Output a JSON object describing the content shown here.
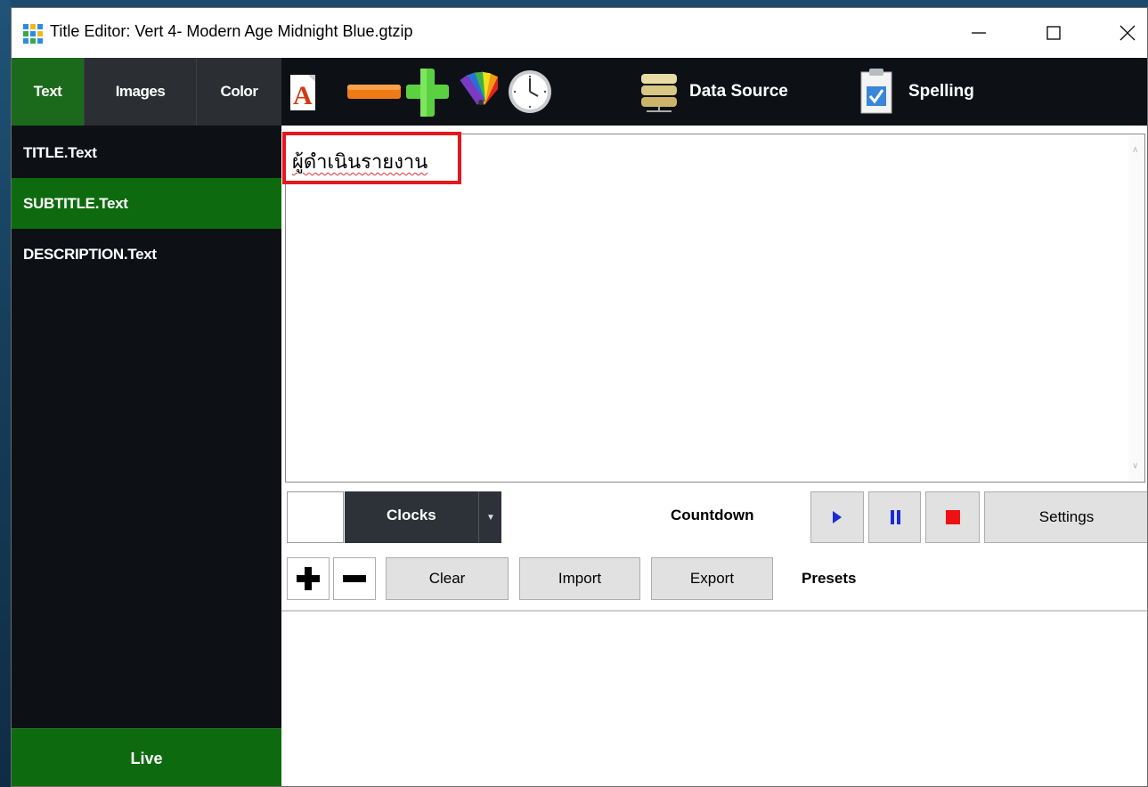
{
  "window": {
    "title": "Title Editor: Vert 4- Modern Age Midnight Blue.gtzip"
  },
  "sidebar": {
    "tabs": [
      {
        "label": "Text",
        "active": true
      },
      {
        "label": "Images",
        "active": false
      },
      {
        "label": "Color",
        "active": false
      }
    ],
    "fields": [
      {
        "label": "TITLE.Text",
        "active": false
      },
      {
        "label": "SUBTITLE.Text",
        "active": true
      },
      {
        "label": "DESCRIPTION.Text",
        "active": false
      }
    ],
    "live_label": "Live"
  },
  "toolbar": {
    "data_source_label": "Data Source",
    "spelling_label": "Spelling",
    "icons": [
      "font-icon",
      "minus-icon",
      "plus-icon",
      "color-palette-icon",
      "clock-icon",
      "database-icon",
      "spellcheck-icon"
    ]
  },
  "editor": {
    "text": "ผู้ดำเนินรายงาน"
  },
  "clock": {
    "combo_value": "Clocks",
    "countdown_label": "Countdown",
    "settings_label": "Settings"
  },
  "presets": {
    "clear_label": "Clear",
    "import_label": "Import",
    "export_label": "Export",
    "label": "Presets"
  },
  "colors": {
    "dark_panel": "#0d1116",
    "active_green": "#0e6a0e",
    "highlight_red": "#e5161d",
    "play_blue": "#1a2bd6",
    "stop_red": "#ee1111"
  }
}
